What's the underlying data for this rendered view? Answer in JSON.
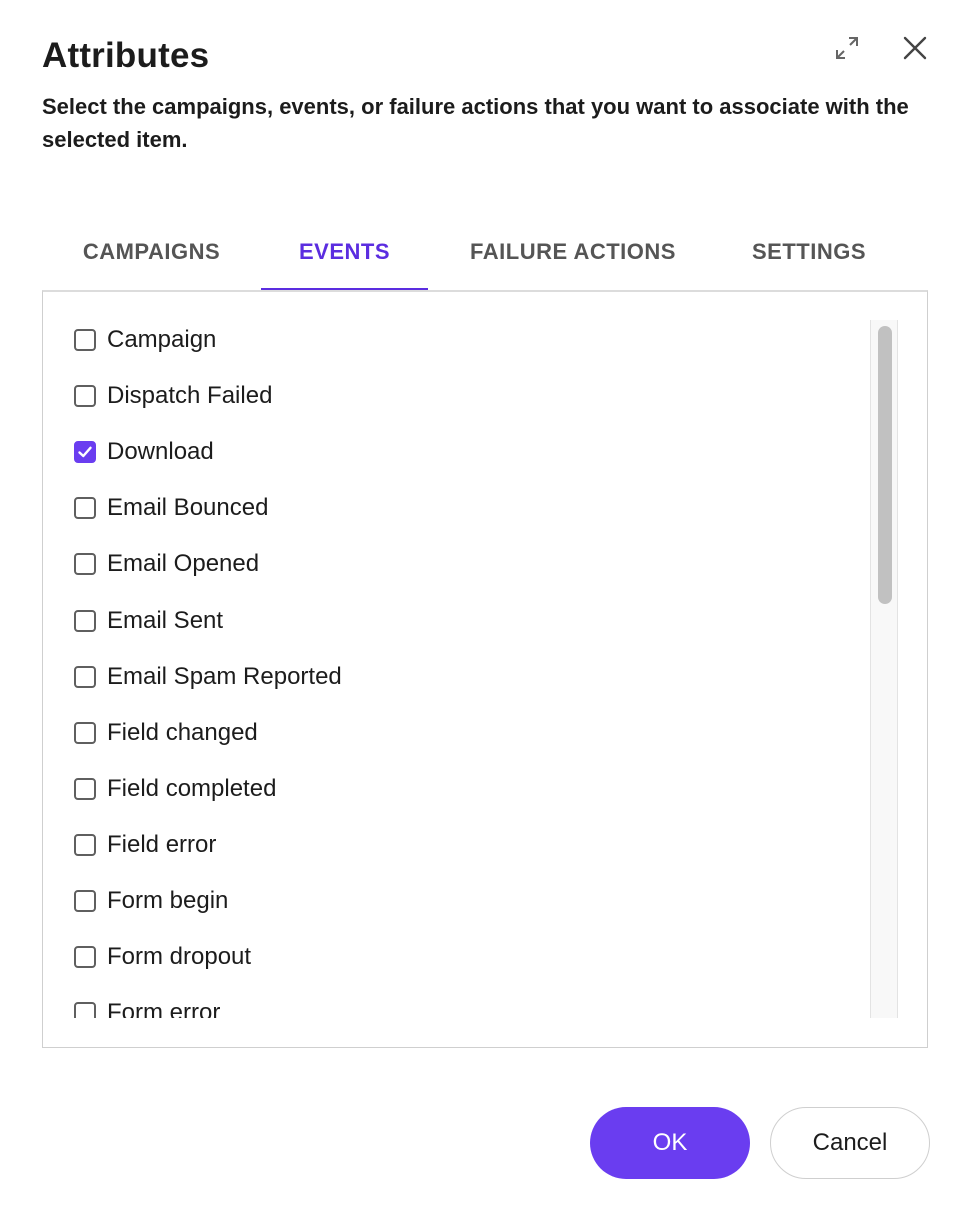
{
  "dialog": {
    "title": "Attributes",
    "subtitle": "Select the campaigns, events, or failure actions that you want to associate with the selected item."
  },
  "tabs": [
    {
      "label": "CAMPAIGNS",
      "active": false
    },
    {
      "label": "EVENTS",
      "active": true
    },
    {
      "label": "FAILURE ACTIONS",
      "active": false
    },
    {
      "label": "SETTINGS",
      "active": false
    }
  ],
  "events": [
    {
      "label": "Campaign",
      "checked": false
    },
    {
      "label": "Dispatch Failed",
      "checked": false
    },
    {
      "label": "Download",
      "checked": true
    },
    {
      "label": "Email Bounced",
      "checked": false
    },
    {
      "label": "Email Opened",
      "checked": false
    },
    {
      "label": "Email Sent",
      "checked": false
    },
    {
      "label": "Email Spam Reported",
      "checked": false
    },
    {
      "label": "Field changed",
      "checked": false
    },
    {
      "label": "Field completed",
      "checked": false
    },
    {
      "label": "Field error",
      "checked": false
    },
    {
      "label": "Form begin",
      "checked": false
    },
    {
      "label": "Form dropout",
      "checked": false
    },
    {
      "label": "Form error",
      "checked": false
    }
  ],
  "footer": {
    "ok_label": "OK",
    "cancel_label": "Cancel"
  },
  "icons": {
    "expand": "expand-icon",
    "close": "close-icon",
    "check": "checkmark-icon"
  },
  "colors": {
    "accent": "#6a3df0",
    "tab_active": "#5b2de0",
    "text": "#1c1c1c",
    "tab_inactive": "#555555"
  }
}
